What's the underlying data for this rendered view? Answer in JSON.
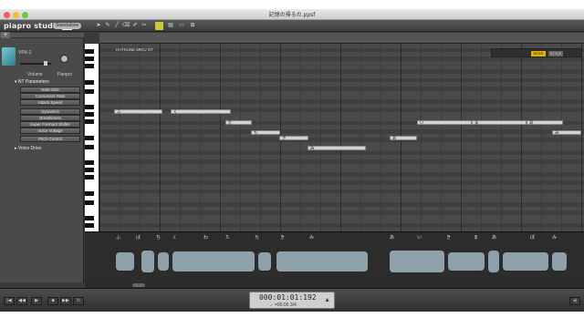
{
  "window": {
    "title": "記憶の帰るの.ppsf"
  },
  "app": {
    "logo_text": "piapro studio",
    "logo_version": "NT",
    "mode": "Standalone"
  },
  "track": {
    "name": "VPX-1",
    "volume_label": "Volume",
    "panpot_label": "Panpot",
    "roll_name": "HATSUNE MIKU NT"
  },
  "nt_params": {
    "title": "NT Parameters",
    "buttons": [
      "Note Size",
      "Consonant Rate",
      "Attack Speed",
      "Dynamics",
      "Breathiness",
      "Super Formant Shifter",
      "Voice Voltage",
      "Pitch Control"
    ]
  },
  "voice_drive": "Voice Drive",
  "editor": {
    "mode_a": "NOTE",
    "mode_b": "STYLE"
  },
  "lyrics": [
    "ふ",
    "ば",
    "ち",
    "く",
    "わ",
    "た",
    "ち",
    "き",
    "み",
    "あ",
    "い",
    "き",
    "ま",
    "あ",
    "ぽ",
    "み"
  ],
  "transport": {
    "time": "000:01:01:192",
    "tempo": "♩=90.00  3/4"
  },
  "colors": {
    "accent": "#e2b400",
    "note": "#d0d2d4",
    "wave": "#8fa2ac"
  }
}
